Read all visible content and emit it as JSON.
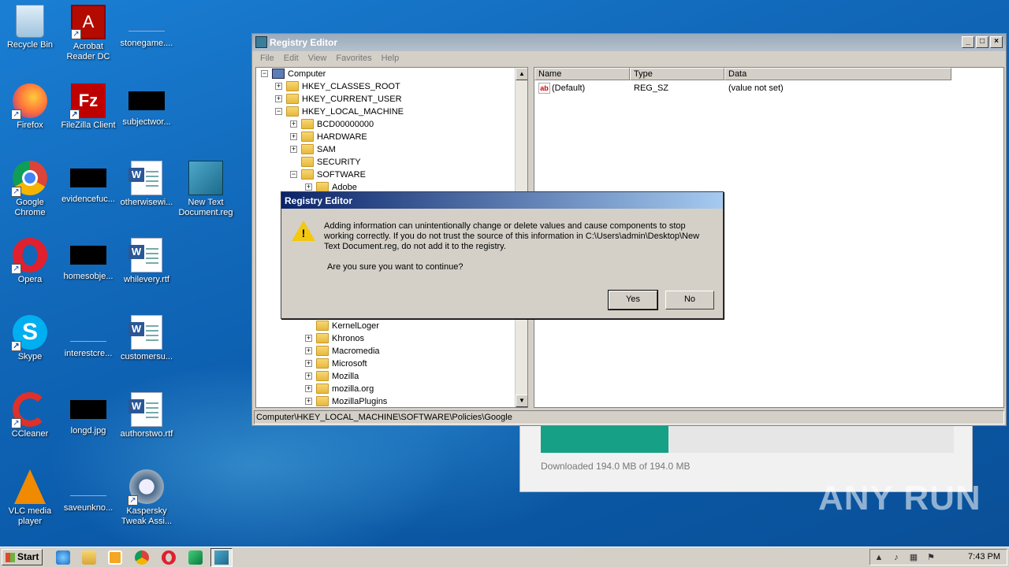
{
  "desktop": {
    "icons": [
      {
        "label": "Recycle Bin"
      },
      {
        "label": "Acrobat Reader DC"
      },
      {
        "label": "stonegame...."
      },
      {
        "label": "Firefox"
      },
      {
        "label": "FileZilla Client"
      },
      {
        "label": "subjectwor..."
      },
      {
        "label": "Google Chrome"
      },
      {
        "label": "evidencefuc..."
      },
      {
        "label": "otherwisewi..."
      },
      {
        "label": "New Text Document.reg"
      },
      {
        "label": "Opera"
      },
      {
        "label": "homesobje..."
      },
      {
        "label": "whilevery.rtf"
      },
      {
        "label": "Skype"
      },
      {
        "label": "interestcre..."
      },
      {
        "label": "customersu..."
      },
      {
        "label": "CCleaner"
      },
      {
        "label": "longd.jpg"
      },
      {
        "label": "authorstwo.rtf"
      },
      {
        "label": "VLC media player"
      },
      {
        "label": "saveunkno..."
      },
      {
        "label": "Kaspersky Tweak Assi..."
      }
    ]
  },
  "download_window": {
    "status": "Downloaded 194.0 MB of 194.0 MB",
    "progress": 0.31,
    "fill_color": "#16a085"
  },
  "regedit": {
    "title": "Registry Editor",
    "menu": [
      "File",
      "Edit",
      "View",
      "Favorites",
      "Help"
    ],
    "tree": [
      {
        "label": "Computer"
      },
      {
        "label": "HKEY_CLASSES_ROOT"
      },
      {
        "label": "HKEY_CURRENT_USER"
      },
      {
        "label": "HKEY_LOCAL_MACHINE"
      },
      {
        "label": "BCD00000000"
      },
      {
        "label": "HARDWARE"
      },
      {
        "label": "SAM"
      },
      {
        "label": "SECURITY"
      },
      {
        "label": "SOFTWARE"
      },
      {
        "label": "Adobe"
      },
      {
        "label": "KernelLoger"
      },
      {
        "label": "Khronos"
      },
      {
        "label": "Macromedia"
      },
      {
        "label": "Microsoft"
      },
      {
        "label": "Mozilla"
      },
      {
        "label": "mozilla.org"
      },
      {
        "label": "MozillaPlugins"
      }
    ],
    "columns": [
      "Name",
      "Type",
      "Data"
    ],
    "values": [
      {
        "icon": "ab",
        "name": "(Default)",
        "type": "REG_SZ",
        "data": "(value not set)"
      }
    ],
    "status": "Computer\\HKEY_LOCAL_MACHINE\\SOFTWARE\\Policies\\Google"
  },
  "dialog": {
    "title": "Registry Editor",
    "message": "Adding information can unintentionally change or delete values and cause components to stop working correctly. If you do not trust the source of this information in C:\\Users\\admin\\Desktop\\New Text Document.reg, do not add it to the registry.",
    "question": "Are you sure you want to continue?",
    "yes": "Yes",
    "no": "No"
  },
  "taskbar": {
    "start": "Start",
    "clock": "7:43 PM"
  },
  "watermark": "ANY RUN"
}
